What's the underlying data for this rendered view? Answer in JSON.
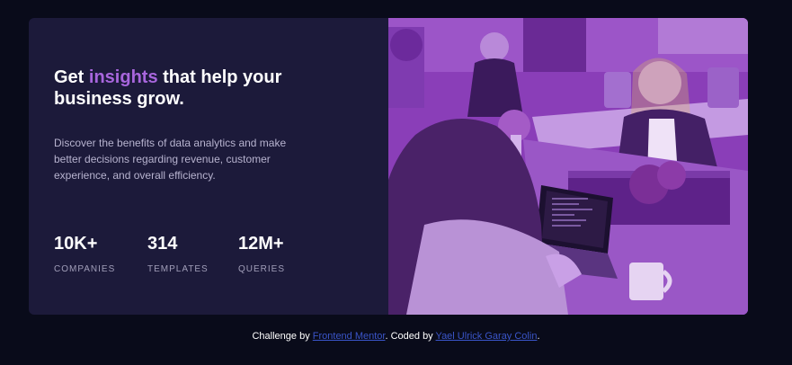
{
  "hero": {
    "title_before": "Get ",
    "title_highlight": "insights",
    "title_after": " that help your business grow.",
    "description": "Discover the benefits of data analytics and make better decisions regarding revenue, customer experience, and overall efficiency."
  },
  "stats": [
    {
      "value": "10K+",
      "label": "COMPANIES"
    },
    {
      "value": "314",
      "label": "TEMPLATES"
    },
    {
      "value": "12M+",
      "label": "QUERIES"
    }
  ],
  "footer": {
    "prefix": "Challenge by ",
    "mentor_link": "Frontend Mentor",
    "middle": ". Coded by ",
    "author_link": "Yael Ulrick Garay Colin",
    "suffix": "."
  },
  "colors": {
    "page_background": "#090b1a",
    "card_background": "#1c1a3a",
    "accent": "#a866dd",
    "photo_overlay": "#8a3eb8",
    "link": "#3a55c9"
  }
}
